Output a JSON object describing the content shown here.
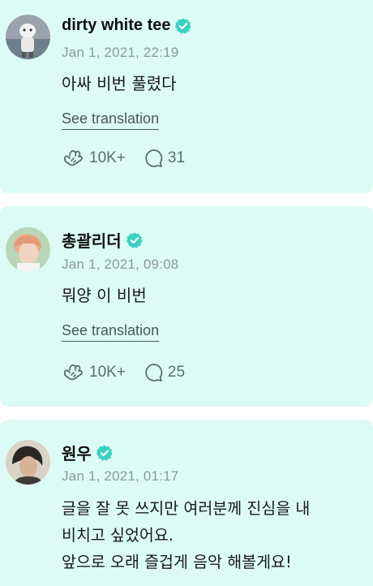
{
  "posts": [
    {
      "author": "dirty white tee",
      "time": "Jan 1, 2021, 22:19",
      "text": "아싸 비번 풀렸다",
      "translate_label": "See translation",
      "likes": "10K+",
      "comments": "31",
      "avatar_icon": "avatar-photo-figurine"
    },
    {
      "author": "총괄리더",
      "time": "Jan 1, 2021, 09:08",
      "text": "뭐양 이 비번",
      "translate_label": "See translation",
      "likes": "10K+",
      "comments": "25",
      "avatar_icon": "avatar-photo-person"
    },
    {
      "author": "원우",
      "time": "Jan 1, 2021, 01:17",
      "text": "글을 잘 못 쓰지만 여러분께 진심을 내\n비치고 싶었어요.\n앞으로 오래 즐겁게 음악 해볼게요!",
      "likes": "",
      "comments": "",
      "avatar_icon": "avatar-photo-person"
    }
  ],
  "colors": {
    "card_bg": "#dcfbf4",
    "verified": "#39d1c1",
    "meta": "#8a9a98",
    "stat": "#56716d"
  }
}
